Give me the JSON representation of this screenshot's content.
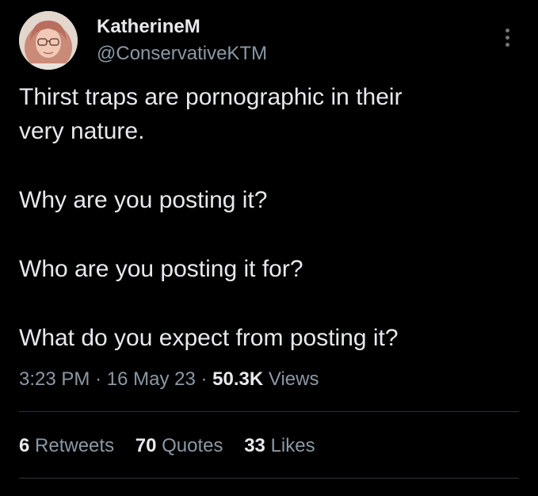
{
  "author": {
    "display_name": "KatherineM",
    "handle": "@ConservativeKTM"
  },
  "tweet": {
    "lines": [
      "Thirst traps are pornographic in their",
      "very nature.",
      "Why are you posting it?",
      "Who are you posting it for?",
      "What do you expect from posting it?"
    ]
  },
  "meta": {
    "time": "3:23 PM",
    "separator": "·",
    "date": "16 May 23",
    "views_count": "50.3K",
    "views_label": "Views"
  },
  "stats": {
    "retweets_count": "6",
    "retweets_label": "Retweets",
    "quotes_count": "70",
    "quotes_label": "Quotes",
    "likes_count": "33",
    "likes_label": "Likes"
  },
  "icons": {
    "more": "more-vertical-icon"
  },
  "colors": {
    "background": "#000000",
    "primary_text": "#e7e9ea",
    "secondary_text": "#8b98a5",
    "divider": "#2f3336"
  }
}
